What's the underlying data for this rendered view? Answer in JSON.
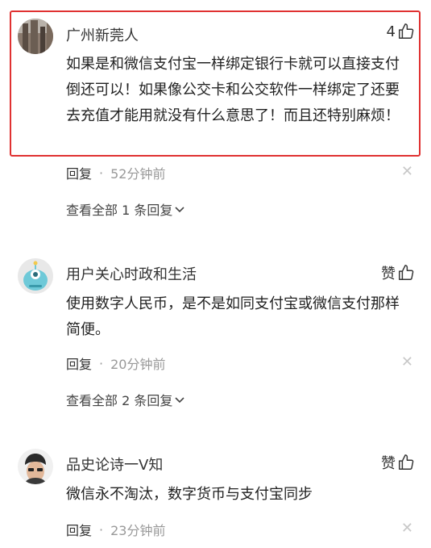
{
  "comments": [
    {
      "username": "广州新莞人",
      "likes": "4",
      "text": "如果是和微信支付宝一样绑定银行卡就可以直接支付倒还可以！如果像公交卡和公交软件一样绑定了还要去充值才能用就没有什么意思了！而且还特别麻烦！",
      "reply": "回复",
      "time": "52分钟前",
      "view_replies": "查看全部 1 条回复"
    },
    {
      "username": "用户关心时政和生活",
      "likes": "赞",
      "text": "使用数字人民币，是不是如同支付宝或微信支付那样简便。",
      "reply": "回复",
      "time": "20分钟前",
      "view_replies": "查看全部 2 条回复"
    },
    {
      "username": "品史论诗一V知",
      "likes": "赞",
      "text": "微信永不淘汰，数字货币与支付宝同步",
      "reply": "回复",
      "time": "23分钟前"
    }
  ],
  "icons": {
    "like": "thumbs-up-icon",
    "close": "close-icon",
    "chevron": "chevron-down-icon"
  },
  "colors": {
    "highlight": "#e03131",
    "meta": "#999999"
  }
}
